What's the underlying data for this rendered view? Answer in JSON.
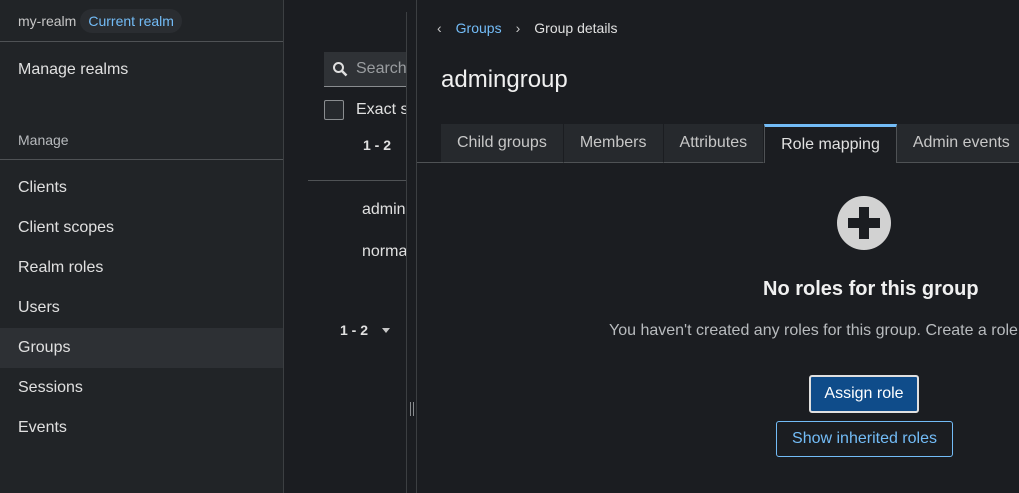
{
  "realm": {
    "name": "my-realm",
    "badge": "Current realm"
  },
  "sidebar": {
    "manage_realms": "Manage realms",
    "section_label": "Manage",
    "items": [
      {
        "label": "Clients"
      },
      {
        "label": "Client scopes"
      },
      {
        "label": "Realm roles"
      },
      {
        "label": "Users"
      },
      {
        "label": "Groups",
        "active": true
      },
      {
        "label": "Sessions"
      },
      {
        "label": "Events"
      }
    ]
  },
  "groups_list": {
    "search_placeholder": "Search",
    "exact_search_label": "Exact s",
    "pagination_top": "1 - 2",
    "rows": [
      "admin",
      "norma"
    ],
    "pagination_bottom": "1 - 2"
  },
  "details": {
    "breadcrumb": {
      "parent": "Groups",
      "current": "Group details"
    },
    "title": "admingroup",
    "tabs": [
      {
        "label": "Child groups"
      },
      {
        "label": "Members"
      },
      {
        "label": "Attributes"
      },
      {
        "label": "Role mapping",
        "active": true
      },
      {
        "label": "Admin events"
      }
    ],
    "empty_state": {
      "icon": "plus-circle-icon",
      "title": "No roles for this group",
      "body": "You haven't created any roles for this group. Create a role t",
      "primary_button": "Assign role",
      "secondary_button": "Show inherited roles"
    }
  },
  "colors": {
    "accent": "#73bcf7",
    "primary_button": "#0f4c8a",
    "background": "#1b1d21",
    "sidebar": "#212427"
  }
}
